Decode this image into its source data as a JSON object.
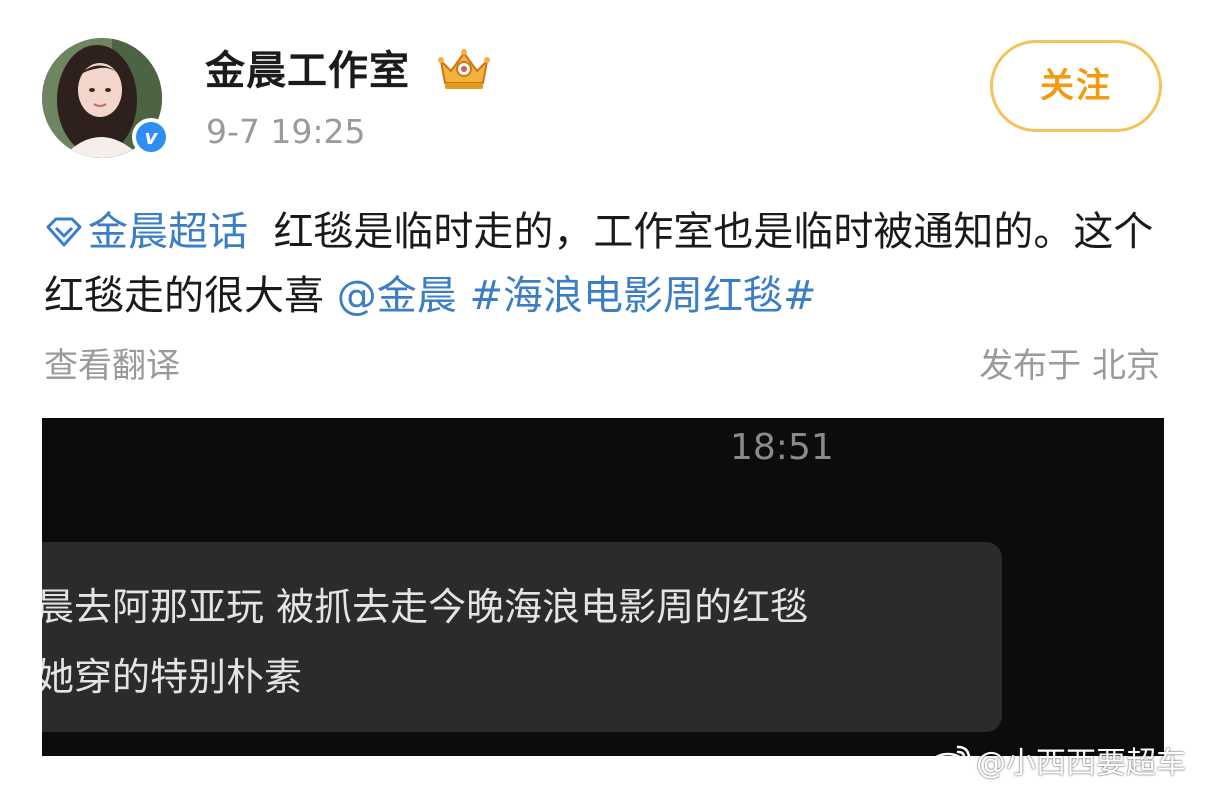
{
  "post": {
    "author": "金晨工作室",
    "timestamp": "9-7 19:25",
    "follow_label": "关注",
    "body": {
      "supertopic": "金晨超话",
      "text1": "红毯是临时走的，工作室也是临时被通知的。这个红毯走的很大喜",
      "mention": "@金晨",
      "hashtag": "#海浪电影周红毯#"
    },
    "translate_label": "查看翻译",
    "location_label": "发布于 北京"
  },
  "chat_image": {
    "time": "18:51",
    "lines": [
      "晨去阿那亚玩  被抓去走今晚海浪电影周的红毯",
      "她穿的特别朴素"
    ]
  },
  "watermark": {
    "text": "@小西西要超车"
  },
  "icons": {
    "verified": "verified-v-icon",
    "crown": "crown-icon",
    "supertopic": "diamond-supertopic-icon",
    "watermark_logo": "weibo-logo-icon"
  },
  "colors": {
    "link": "#3b7ec4",
    "follow": "#f29a10",
    "follow_border": "#f2c35a",
    "verified": "#2f8ef2",
    "secondary_text": "#9a9a9a",
    "chat_bg": "#0c0c0c",
    "bubble_bg": "#2b2b2b"
  }
}
